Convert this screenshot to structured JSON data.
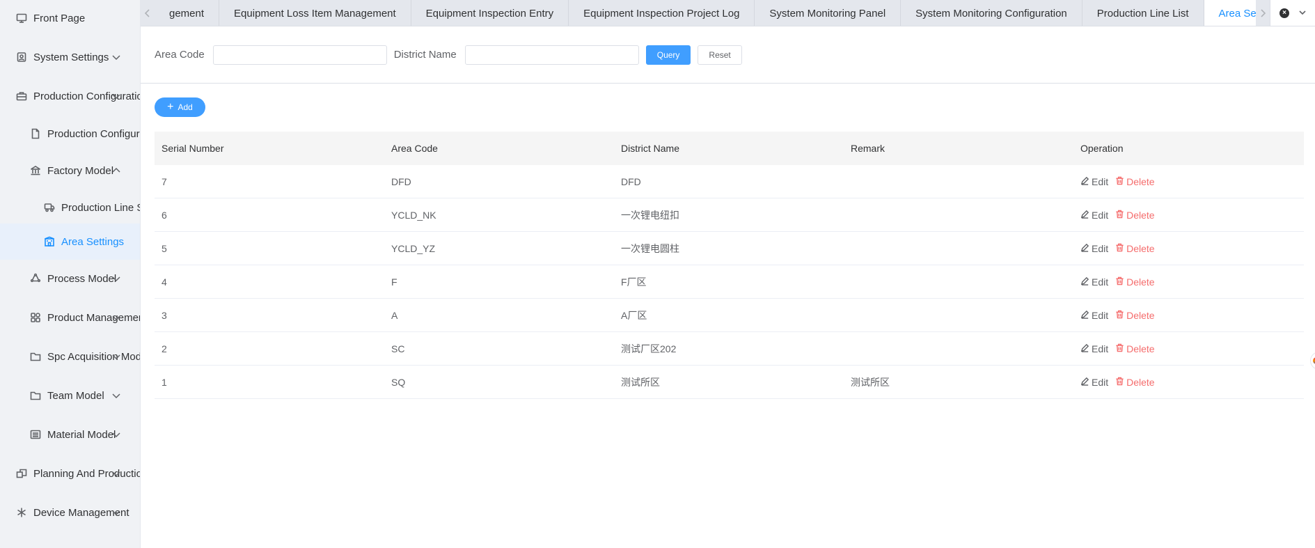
{
  "sidebar": {
    "items": [
      {
        "label": "Front Page",
        "icon": "monitor-icon",
        "level": 1,
        "arrow": ""
      },
      {
        "label": "System Settings",
        "icon": "user-cog-icon",
        "level": 1,
        "arrow": "down"
      },
      {
        "label": "Production Configuration",
        "icon": "briefcase-icon",
        "level": 1,
        "arrow": "down"
      },
      {
        "label": "Production Configuration",
        "icon": "document-icon",
        "level": 2,
        "arrow": ""
      },
      {
        "label": "Factory Model",
        "icon": "bank-icon",
        "level": 2,
        "arrow": "up"
      },
      {
        "label": "Production Line Settings",
        "icon": "truck-icon",
        "level": 3,
        "arrow": ""
      },
      {
        "label": "Area Settings",
        "icon": "building-icon",
        "level": 3,
        "arrow": "",
        "active": true
      },
      {
        "label": "Process Model",
        "icon": "cycle-icon",
        "level": 2,
        "arrow": "down"
      },
      {
        "label": "Product Management",
        "icon": "grid-icon",
        "level": 2,
        "arrow": "down"
      },
      {
        "label": "Spc Acquisition Model",
        "icon": "folder-icon",
        "level": 2,
        "arrow": "down"
      },
      {
        "label": "Team Model",
        "icon": "folder-icon",
        "level": 2,
        "arrow": "down"
      },
      {
        "label": "Material Model",
        "icon": "list-icon",
        "level": 2,
        "arrow": "down"
      },
      {
        "label": "Planning And Production",
        "icon": "copy-icon",
        "level": 1,
        "arrow": "down"
      },
      {
        "label": "Device Management",
        "icon": "asterisk-icon",
        "level": 1,
        "arrow": "down"
      }
    ]
  },
  "tabs": {
    "items": [
      {
        "label": "gement"
      },
      {
        "label": "Equipment Loss Item Management"
      },
      {
        "label": "Equipment Inspection Entry"
      },
      {
        "label": "Equipment Inspection Project Log"
      },
      {
        "label": "System Monitoring Panel"
      },
      {
        "label": "System Monitoring Configuration"
      },
      {
        "label": "Production Line List"
      },
      {
        "label": "Area Settings",
        "active": true,
        "close": "×"
      }
    ],
    "close_all_glyph": "×"
  },
  "search": {
    "area_code_label": "Area Code",
    "area_code_value": "",
    "district_name_label": "District Name",
    "district_name_value": "",
    "query_label": "Query",
    "reset_label": "Reset"
  },
  "toolbar": {
    "add_label": "Add",
    "add_glyph": "+"
  },
  "table": {
    "columns": [
      "Serial Number",
      "Area Code",
      "District Name",
      "Remark",
      "Operation"
    ],
    "edit_label": "Edit",
    "delete_label": "Delete",
    "rows": [
      {
        "serial": "7",
        "code": "DFD",
        "district": "DFD",
        "remark": ""
      },
      {
        "serial": "6",
        "code": "YCLD_NK",
        "district": "一次锂电纽扣",
        "remark": ""
      },
      {
        "serial": "5",
        "code": "YCLD_YZ",
        "district": "一次锂电圆柱",
        "remark": ""
      },
      {
        "serial": "4",
        "code": "F",
        "district": "F厂区",
        "remark": ""
      },
      {
        "serial": "3",
        "code": "A",
        "district": "A厂区",
        "remark": ""
      },
      {
        "serial": "2",
        "code": "SC",
        "district": "测试厂区202",
        "remark": ""
      },
      {
        "serial": "1",
        "code": "SQ",
        "district": "测试所区",
        "remark": "测试所区"
      }
    ]
  },
  "colors": {
    "accent": "#1890ff",
    "primary_button": "#409eff",
    "danger": "#f56c6c",
    "sidebar_bg": "#f0f2f5",
    "active_item_bg": "#e8f0fb"
  }
}
